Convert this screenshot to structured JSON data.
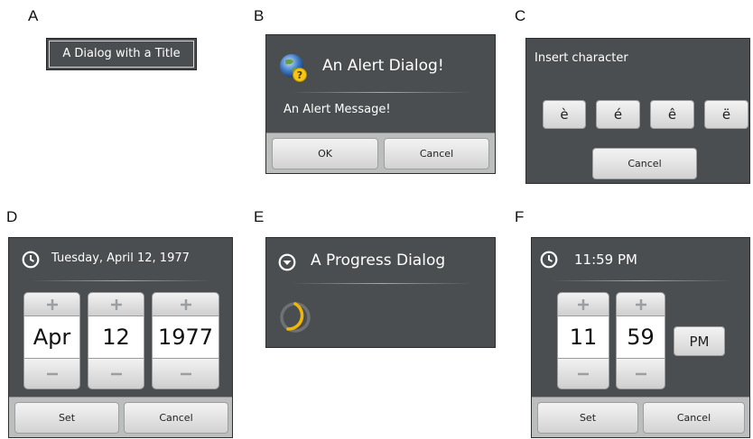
{
  "panel_labels": [
    "A",
    "B",
    "C",
    "D",
    "E",
    "F"
  ],
  "dialog_a": {
    "title": "A Dialog with a Title"
  },
  "dialog_b": {
    "title": "An Alert Dialog!",
    "message": "An Alert Message!",
    "ok_label": "OK",
    "cancel_label": "Cancel",
    "icon": "globe-warning-icon"
  },
  "dialog_c": {
    "title": "Insert character",
    "chars": [
      "è",
      "é",
      "ê",
      "ë"
    ],
    "cancel_label": "Cancel"
  },
  "dialog_d": {
    "title": "Tuesday, April 12, 1977",
    "month": "Apr",
    "day": "12",
    "year": "1977",
    "set_label": "Set",
    "cancel_label": "Cancel",
    "icon": "clock-icon"
  },
  "dialog_e": {
    "title": "A Progress Dialog",
    "icon": "chevron-down-circle-icon",
    "spinner_color": "#f2b705"
  },
  "dialog_f": {
    "title": "11:59 PM",
    "hour": "11",
    "minute": "59",
    "ampm": "PM",
    "set_label": "Set",
    "cancel_label": "Cancel",
    "icon": "clock-icon"
  },
  "colors": {
    "dialog_bg": "#4b4e50",
    "button_bar": "#bcbdbd",
    "spinner_accent": "#f2b705"
  }
}
